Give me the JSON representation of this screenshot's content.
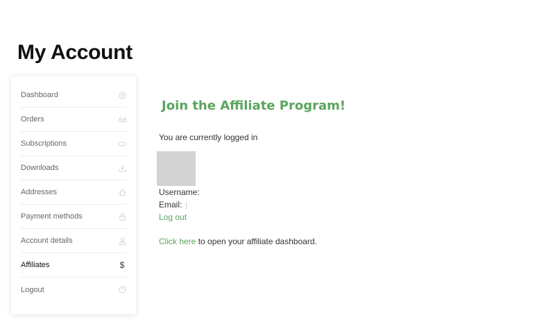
{
  "page_title": "My Account",
  "nav": {
    "items": [
      {
        "label": "Dashboard",
        "icon": "dashboard-icon",
        "active": false
      },
      {
        "label": "Orders",
        "icon": "orders-icon",
        "active": false
      },
      {
        "label": "Subscriptions",
        "icon": "subscriptions-icon",
        "active": false
      },
      {
        "label": "Downloads",
        "icon": "download-icon",
        "active": false
      },
      {
        "label": "Addresses",
        "icon": "home-icon",
        "active": false
      },
      {
        "label": "Payment methods",
        "icon": "lock-icon",
        "active": false
      },
      {
        "label": "Account details",
        "icon": "user-icon",
        "active": false
      },
      {
        "label": "Affiliates",
        "icon": "dollar-icon",
        "active": true
      },
      {
        "label": "Logout",
        "icon": "logout-icon",
        "active": false
      }
    ],
    "affiliates_icon_glyph": "$"
  },
  "main": {
    "heading": "Join the Affiliate Program!",
    "logged_in_text": "You are currently logged in",
    "username_label": "Username:",
    "email_label": "Email:",
    "logout_link": "Log out",
    "click_here_link": "Click here",
    "dashboard_text": " to open your affiliate dashboard."
  },
  "colors": {
    "accent": "#5aa55d",
    "avatar_placeholder": "#d3d3d3"
  }
}
